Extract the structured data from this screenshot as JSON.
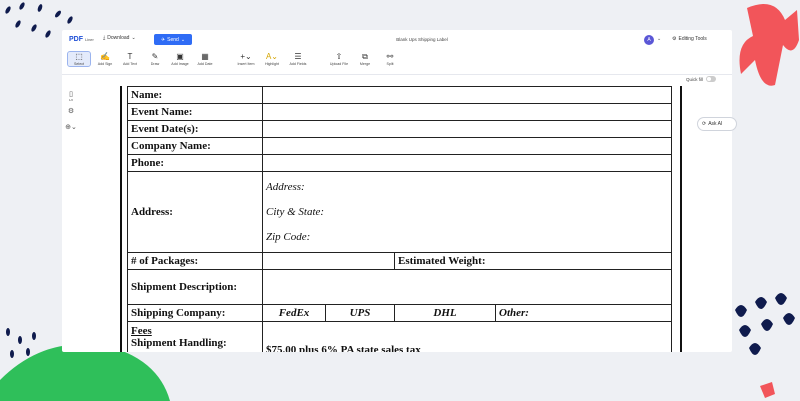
{
  "app": {
    "logo": "PDF",
    "logo_sub": "Liner",
    "download_label": "Download",
    "send_label": "Send",
    "doc_title": "Blank Ups Shipping Label",
    "avatar_initial": "A",
    "editing_tools_label": "Editing Tools",
    "quick_fill_label": "Quick fill",
    "ask_ai_label": "Ask AI"
  },
  "toolbar": {
    "tools": [
      {
        "label": "Select",
        "icon": "select-icon"
      },
      {
        "label": "Add Sign",
        "icon": "sign-icon"
      },
      {
        "label": "Add Text",
        "icon": "text-icon"
      },
      {
        "label": "Draw",
        "icon": "pen-icon"
      },
      {
        "label": "Add Image",
        "icon": "image-icon"
      },
      {
        "label": "Add Date",
        "icon": "calendar-icon"
      },
      {
        "label": "Insert Item",
        "icon": "plus-icon"
      },
      {
        "label": "Highlight",
        "icon": "highlight-icon"
      },
      {
        "label": "Add Fields",
        "icon": "fields-icon"
      },
      {
        "label": "Upload File",
        "icon": "upload-icon"
      },
      {
        "label": "Merge",
        "icon": "merge-icon"
      },
      {
        "label": "Split",
        "icon": "split-icon"
      }
    ]
  },
  "rail": {
    "items": [
      {
        "label": "1/2",
        "icon": "pages-icon"
      },
      {
        "label": "",
        "icon": "gear-icon"
      },
      {
        "label": "",
        "icon": "zoom-icon"
      }
    ]
  },
  "form": {
    "name": "Name:",
    "event_name": "Event Name:",
    "event_dates": "Event Date(s):",
    "company_name": "Company Name:",
    "phone": "Phone:",
    "address": "Address:",
    "address_line": "Address:",
    "city_state": "City & State:",
    "zip_code": "Zip Code:",
    "packages": "# of Packages:",
    "estimated_weight": "Estimated Weight:",
    "shipment_description": "Shipment Description:",
    "shipping_company": "Shipping Company:",
    "carriers": [
      "FedEx",
      "UPS",
      "DHL",
      "Other:"
    ],
    "fees": "Fees",
    "shipment_handling": "Shipment Handling:",
    "handling_value": "$75.00 plus 6% PA state sales tax"
  },
  "colors": {
    "accent": "#2f6cf5",
    "avatar": "#5b57d6",
    "deco_red": "#f2555a",
    "deco_green": "#2fbf5a",
    "deco_navy": "#0f1b4d"
  }
}
